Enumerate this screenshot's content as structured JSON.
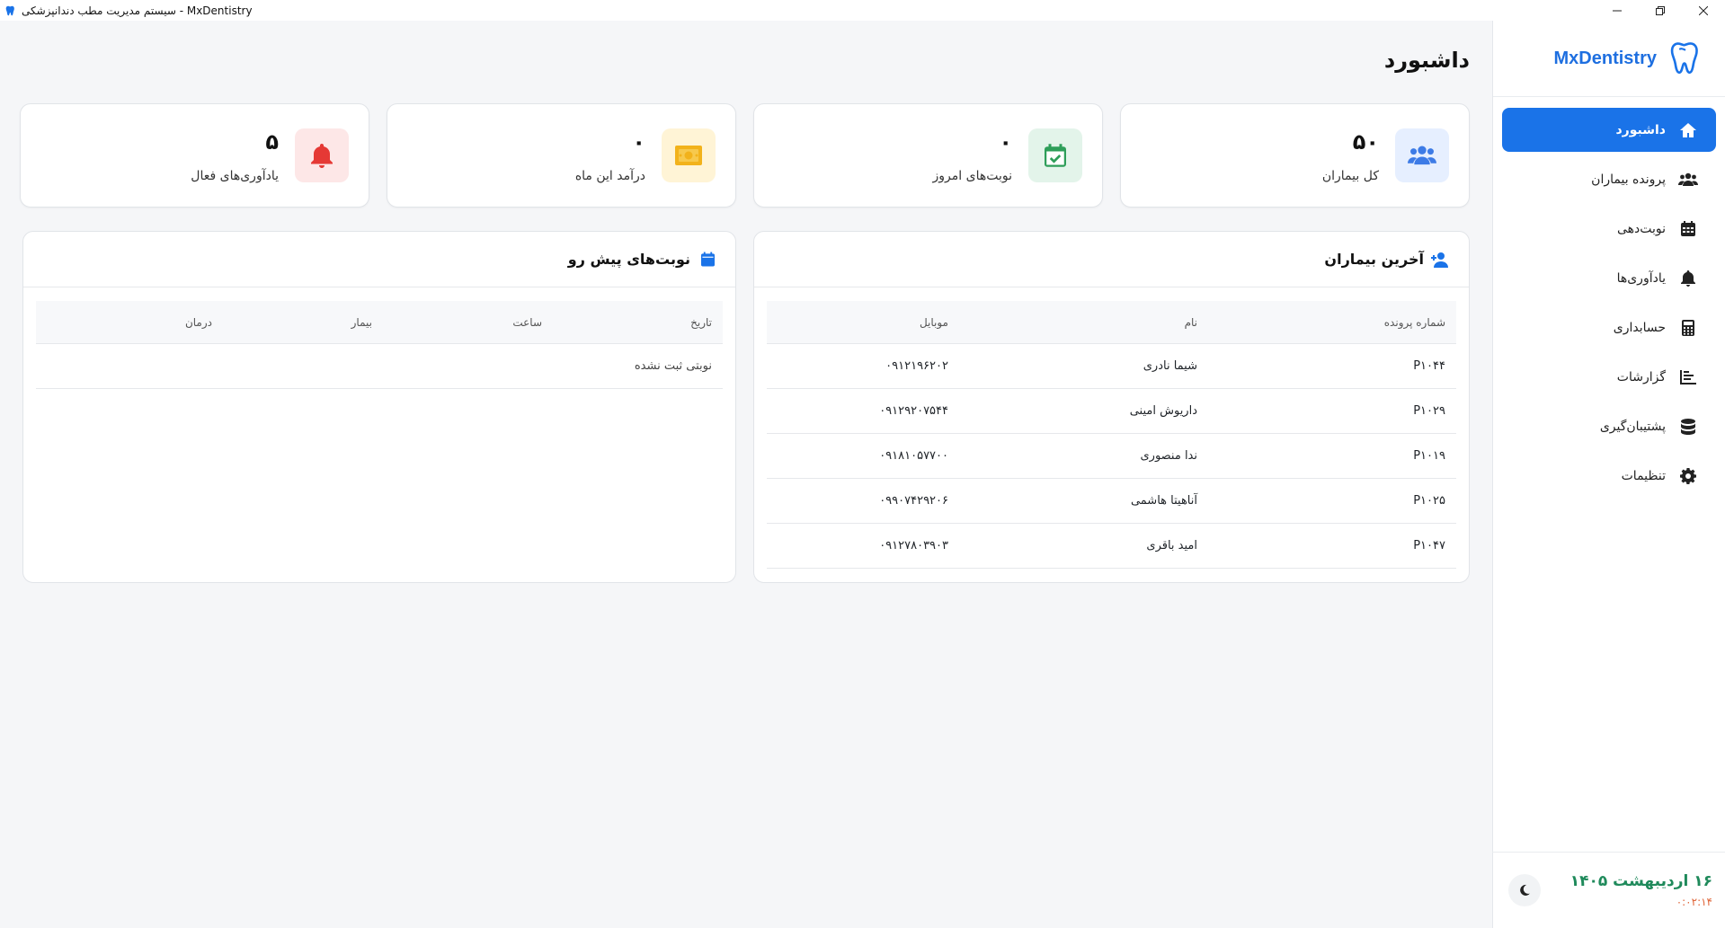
{
  "window": {
    "title": "سیستم مدیریت مطب دندانپزشکی - MxDentistry"
  },
  "brand": {
    "name": "MxDentistry",
    "accent": "#1a73e8"
  },
  "sidebar": {
    "items": [
      {
        "label": "داشبورد",
        "icon": "home-icon"
      },
      {
        "label": "پرونده بیماران",
        "icon": "users-icon"
      },
      {
        "label": "نوبت‌دهی",
        "icon": "calendar-icon"
      },
      {
        "label": "یادآوری‌ها",
        "icon": "bell-icon"
      },
      {
        "label": "حسابداری",
        "icon": "calculator-icon"
      },
      {
        "label": "گزارشات",
        "icon": "chart-icon"
      },
      {
        "label": "پشتیبان‌گیری",
        "icon": "database-icon"
      },
      {
        "label": "تنظیمات",
        "icon": "gear-icon"
      }
    ],
    "footer": {
      "date": "۱۶ اردیبهشت ۱۴۰۵",
      "time": "۰:۰۲:۱۴",
      "theme_icon": "moon-icon"
    }
  },
  "page": {
    "title": "داشبورد"
  },
  "stats": [
    {
      "value": "۵۰",
      "label": "کل بیماران",
      "icon": "users-icon",
      "bg": "#e6efff",
      "fg": "#3d7be6"
    },
    {
      "value": "۰",
      "label": "نوبت‌های امروز",
      "icon": "calendar-check-icon",
      "bg": "#e3f4ea",
      "fg": "#2e9e59"
    },
    {
      "value": "۰",
      "label": "درآمد این ماه",
      "icon": "money-icon",
      "bg": "#fff4d6",
      "fg": "#f2b21b"
    },
    {
      "value": "۵",
      "label": "یادآوری‌های فعال",
      "icon": "bell-icon",
      "bg": "#fde7e7",
      "fg": "#e53935"
    }
  ],
  "recent_patients": {
    "title": "آخرین بیماران",
    "columns": [
      "شماره پرونده",
      "نام",
      "موبایل"
    ],
    "rows": [
      [
        "P۱۰۴۴",
        "شیما نادری",
        "۰۹۱۲۱۹۶۲۰۲"
      ],
      [
        "P۱۰۲۹",
        "داریوش امینی",
        "۰۹۱۲۹۲۰۷۵۴۴"
      ],
      [
        "P۱۰۱۹",
        "ندا منصوری",
        "۰۹۱۸۱۰۵۷۷۰۰"
      ],
      [
        "P۱۰۲۵",
        "آناهیتا هاشمی",
        "۰۹۹۰۷۴۲۹۲۰۶"
      ],
      [
        "P۱۰۴۷",
        "امید باقری",
        "۰۹۱۲۷۸۰۳۹۰۳"
      ]
    ]
  },
  "upcoming": {
    "title": "نوبت‌های پیش رو",
    "columns": [
      "تاریخ",
      "ساعت",
      "بیمار",
      "درمان"
    ],
    "empty_text": "نوبتی ثبت نشده"
  }
}
